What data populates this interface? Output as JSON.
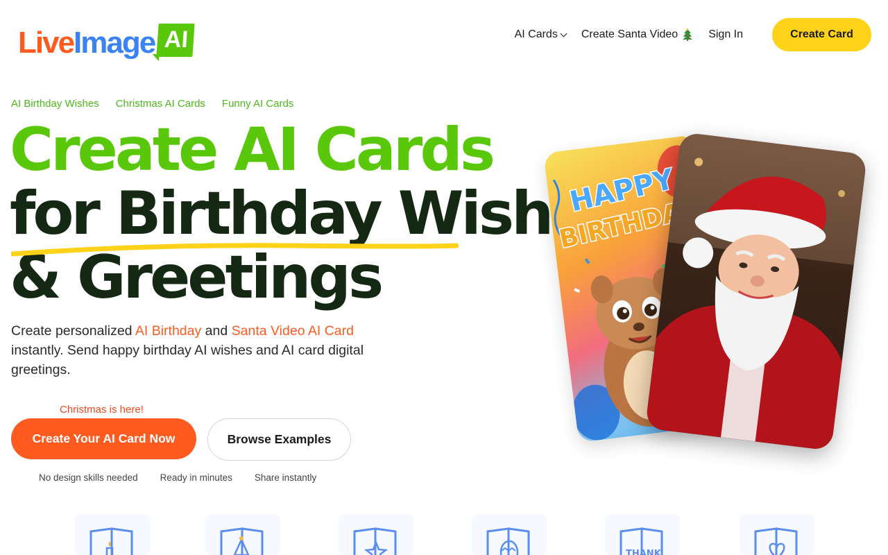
{
  "brand": {
    "logo_part1": "Live",
    "logo_part2": "Image",
    "logo_badge": "AI"
  },
  "nav": {
    "ai_cards": "AI Cards",
    "santa_video": "Create Santa Video",
    "sign_in": "Sign In",
    "create_card": "Create Card"
  },
  "hero": {
    "crumbs": [
      "AI Birthday Wishes",
      "Christmas AI Cards",
      "Funny AI Cards"
    ],
    "title_line1": "Create AI Cards",
    "title_line2": "for Birthday Wishes",
    "title_line3": "& Greetings",
    "sub_pre": "Create personalized ",
    "sub_hl1": "AI Birthday",
    "sub_mid": " and ",
    "sub_hl2": "Santa Video AI Card",
    "sub_post": " instantly. Send happy birthday AI wishes and AI card digital greetings.",
    "xmas_note": "Christmas is here!",
    "cta_primary": "Create Your AI Card Now",
    "cta_secondary": "Browse Examples",
    "features": [
      "No design skills needed",
      "Ready in minutes",
      "Share instantly"
    ]
  },
  "cards_art": {
    "bday_text1": "HAPPY",
    "bday_text2": "BIRTHDA"
  },
  "categories": {
    "thank_label": "THANK",
    "icons": [
      "birthday-card-icon",
      "christmas-card-icon",
      "star-card-icon",
      "easter-card-icon",
      "thank-you-card-icon",
      "love-card-icon"
    ]
  },
  "colors": {
    "accent_green": "#5ac80a",
    "accent_orange": "#ff5a1f",
    "accent_yellow": "#ffd21a",
    "logo_blue": "#3b82f6",
    "title_dark": "#142814"
  }
}
